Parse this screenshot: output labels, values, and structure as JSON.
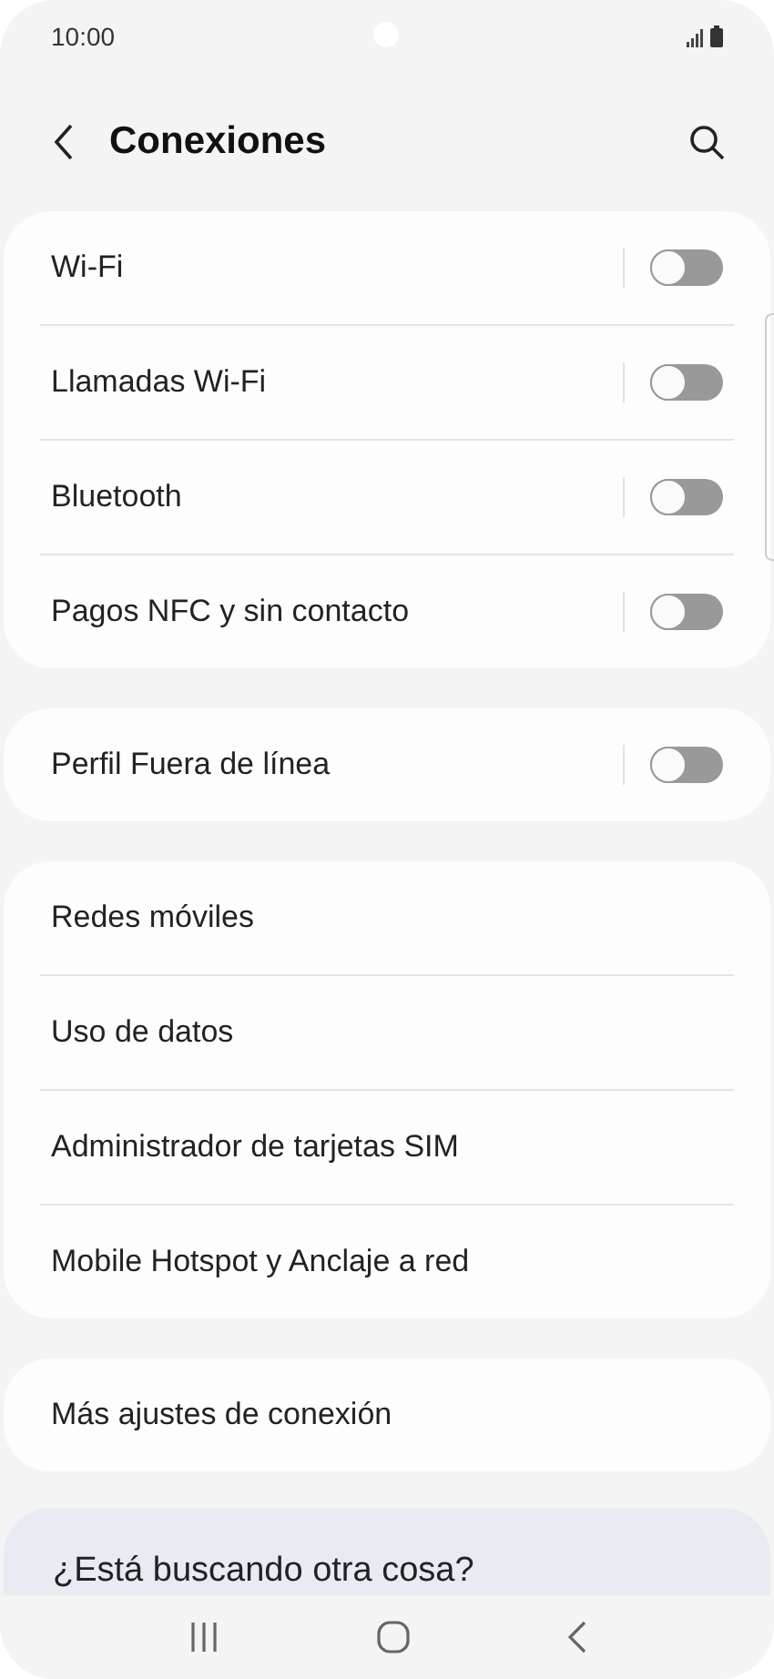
{
  "status_bar": {
    "time": "10:00"
  },
  "header": {
    "title": "Conexiones"
  },
  "groups": [
    {
      "items": [
        {
          "label": "Wi-Fi",
          "kind": "toggle",
          "on": false
        },
        {
          "label": "Llamadas Wi-Fi",
          "kind": "toggle",
          "on": false
        },
        {
          "label": "Bluetooth",
          "kind": "toggle",
          "on": false
        },
        {
          "label": "Pagos NFC y sin contacto",
          "kind": "toggle",
          "on": false
        }
      ]
    },
    {
      "items": [
        {
          "label": "Perfil Fuera de línea",
          "kind": "toggle",
          "on": false
        }
      ]
    },
    {
      "items": [
        {
          "label": "Redes móviles",
          "kind": "link"
        },
        {
          "label": "Uso de datos",
          "kind": "link"
        },
        {
          "label": "Administrador de tarjetas SIM",
          "kind": "link"
        },
        {
          "label": "Mobile Hotspot y Anclaje a red",
          "kind": "link"
        }
      ]
    },
    {
      "items": [
        {
          "label": "Más ajustes de conexión",
          "kind": "link"
        }
      ]
    }
  ],
  "suggestion": {
    "title": "¿Está buscando otra cosa?"
  }
}
